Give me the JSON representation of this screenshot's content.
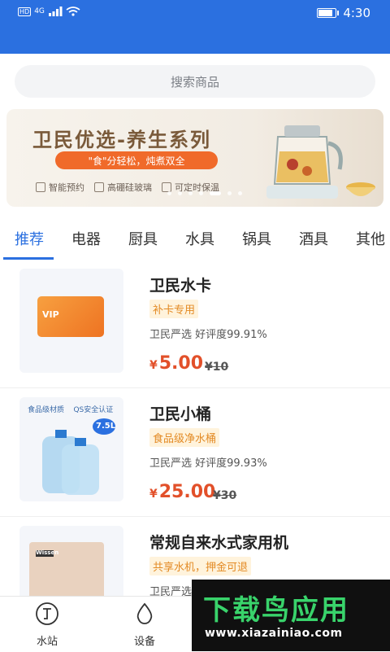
{
  "status_bar": {
    "network": "4G",
    "hd": "HD",
    "time": "4:30",
    "battery_percent": 85
  },
  "search": {
    "placeholder": "搜索商品"
  },
  "banner": {
    "title": "卫民优选-养生系列",
    "slogan": "\"食\"分轻松，炖煮双全",
    "features": [
      "智能预约",
      "高硼硅玻璃",
      "可定时保温"
    ],
    "active_dot": 4
  },
  "tabs": [
    "推荐",
    "电器",
    "厨具",
    "水具",
    "锅具",
    "酒具",
    "其他"
  ],
  "active_tab": "推荐",
  "products": [
    {
      "name": "卫民水卡",
      "tag": "补卡专用",
      "desc": "卫民严选 好评度99.91%",
      "price": "5.00",
      "old_price": "¥10",
      "currency": "¥",
      "thumb_text": "VIP"
    },
    {
      "name": "卫民小桶",
      "tag": "食品级净水桶",
      "desc": "卫民严选 好评度99.93%",
      "price": "25.00",
      "old_price": "¥30",
      "currency": "¥",
      "thumb_text": "7.5L",
      "thumb_caption": "食品级材质    QS安全认证"
    },
    {
      "name": "常规自来水式家用机",
      "tag": "共享水机，押金可退",
      "desc": "卫民严选",
      "thumb_text": "Wissen"
    }
  ],
  "bottom_nav": [
    {
      "label": "水站",
      "icon": "water-station-icon"
    },
    {
      "label": "设备",
      "icon": "water-drop-icon"
    }
  ],
  "watermark": {
    "title": "下载鸟应用",
    "url": "www.xiazainiao.com"
  },
  "colors": {
    "primary": "#2b70e0",
    "price": "#e2502a",
    "tag_text": "#e38a24",
    "tag_bg": "#fff3dc"
  }
}
